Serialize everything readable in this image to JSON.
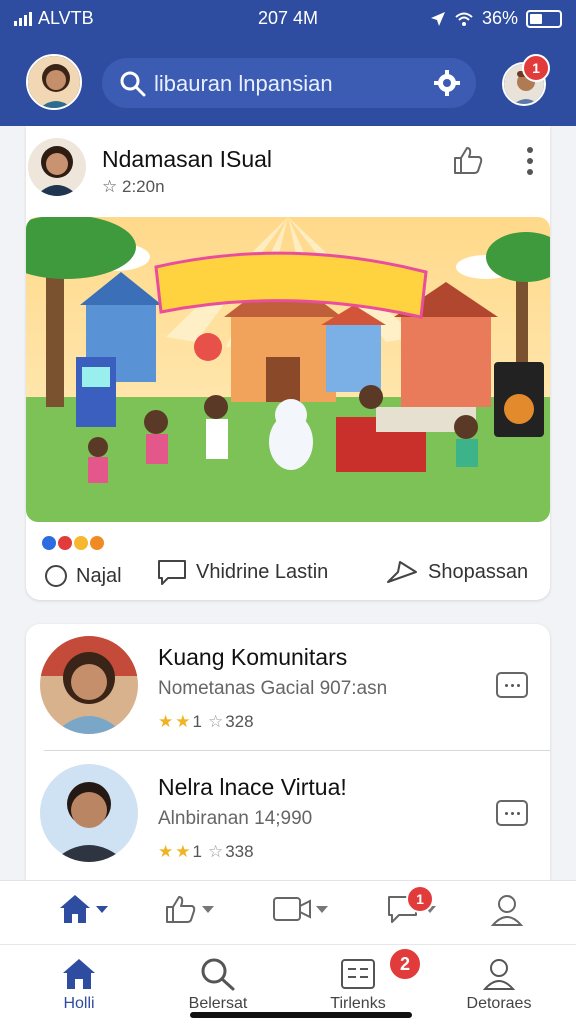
{
  "status_bar": {
    "carrier": "ALVTB",
    "time": "207 4M",
    "battery": "36%"
  },
  "header": {
    "search_placeholder": "libauran lnpansian",
    "notification_count": "1"
  },
  "post": {
    "author": "Ndamasan ISual",
    "time": "2:20n",
    "actions": {
      "react": "Najal",
      "comment": "Vhidrine Lastin",
      "share": "Shopassan"
    },
    "colors": {
      "accent": "#2f4da0"
    }
  },
  "communities": [
    {
      "title": "Kuang Komunitars",
      "subtitle": "Nometanas Gacial 907:asn",
      "rating_count": "1",
      "rating_total": "328"
    },
    {
      "title": "Nelra lnace Virtua!",
      "subtitle": "Alnbiranan 14;990",
      "rating_count": "1",
      "rating_total": "338"
    }
  ],
  "icon_bar": {
    "chat_badge": "1"
  },
  "bottom_nav": [
    {
      "label": "Holli"
    },
    {
      "label": "Belersat"
    },
    {
      "label": "Tirlenks",
      "badge": "2"
    },
    {
      "label": "Detoraes"
    }
  ]
}
